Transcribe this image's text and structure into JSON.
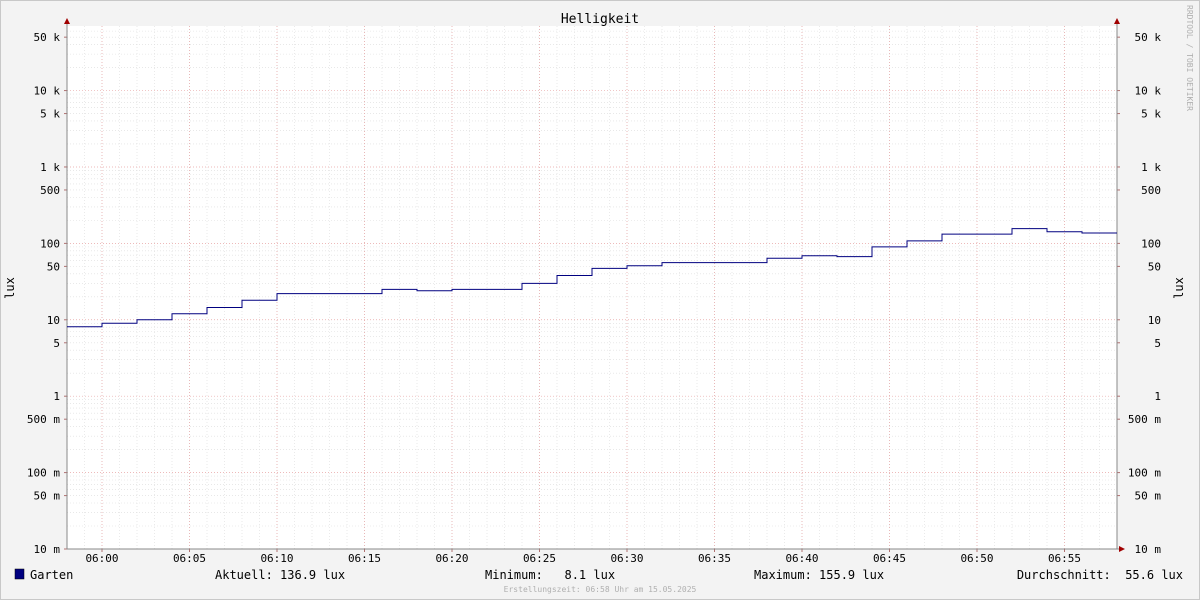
{
  "chart_data": {
    "type": "line",
    "title": "Helligkeit",
    "ylabel": "lux",
    "ylabel_right": "lux",
    "yscale": "log",
    "ylim": [
      0.01,
      70000
    ],
    "xlim": [
      "05:58",
      "06:58"
    ],
    "y_ticks": [
      {
        "value": 50000,
        "label": "50 k"
      },
      {
        "value": 10000,
        "label": "10 k"
      },
      {
        "value": 5000,
        "label": "5 k"
      },
      {
        "value": 1000,
        "label": "1 k"
      },
      {
        "value": 500,
        "label": "500"
      },
      {
        "value": 100,
        "label": "100"
      },
      {
        "value": 50,
        "label": "50"
      },
      {
        "value": 10,
        "label": "10"
      },
      {
        "value": 5,
        "label": "5"
      },
      {
        "value": 1,
        "label": "1"
      },
      {
        "value": 0.5,
        "label": "500 m"
      },
      {
        "value": 0.1,
        "label": "100 m"
      },
      {
        "value": 0.05,
        "label": "50 m"
      },
      {
        "value": 0.01,
        "label": "10 m"
      }
    ],
    "x_ticks": [
      "06:00",
      "06:05",
      "06:10",
      "06:15",
      "06:20",
      "06:25",
      "06:30",
      "06:35",
      "06:40",
      "06:45",
      "06:50",
      "06:55"
    ],
    "grid": true,
    "series": [
      {
        "name": "Garten",
        "color": "#000080",
        "points": [
          {
            "x": "05:58",
            "y": 8.1
          },
          {
            "x": "06:00",
            "y": 9.0
          },
          {
            "x": "06:02",
            "y": 10.0
          },
          {
            "x": "06:04",
            "y": 12.0
          },
          {
            "x": "06:06",
            "y": 14.5
          },
          {
            "x": "06:08",
            "y": 18.0
          },
          {
            "x": "06:10",
            "y": 22.0
          },
          {
            "x": "06:16",
            "y": 25.0
          },
          {
            "x": "06:18",
            "y": 24.0
          },
          {
            "x": "06:20",
            "y": 25.0
          },
          {
            "x": "06:24",
            "y": 30.0
          },
          {
            "x": "06:26",
            "y": 38.0
          },
          {
            "x": "06:28",
            "y": 47.0
          },
          {
            "x": "06:30",
            "y": 51.0
          },
          {
            "x": "06:32",
            "y": 56.0
          },
          {
            "x": "06:38",
            "y": 64.0
          },
          {
            "x": "06:40",
            "y": 69.0
          },
          {
            "x": "06:42",
            "y": 67.0
          },
          {
            "x": "06:44",
            "y": 90.0
          },
          {
            "x": "06:46",
            "y": 108.0
          },
          {
            "x": "06:48",
            "y": 132.0
          },
          {
            "x": "06:52",
            "y": 155.9
          },
          {
            "x": "06:54",
            "y": 142.0
          },
          {
            "x": "06:56",
            "y": 136.9
          },
          {
            "x": "06:58",
            "y": 136.9
          }
        ]
      }
    ],
    "legend": {
      "series_name": "Garten",
      "current": "Aktuell: 136.9 lux",
      "minimum": "Minimum:   8.1 lux",
      "maximum": "Maximum: 155.9 lux",
      "average": "Durchschnitt:  55.6 lux"
    },
    "watermark": "RRDTOOL / TOBI OETIKER",
    "footer": "Erstellungszeit: 06:58 Uhr am 15.05.2025"
  }
}
